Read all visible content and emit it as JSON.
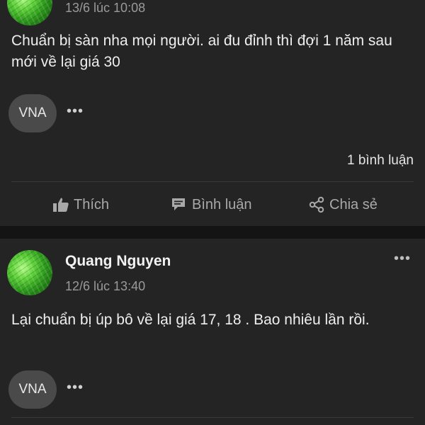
{
  "post1": {
    "timestamp": "13/6 lúc 10:08",
    "body": "Chuẩn bị sàn nha mọi người. ai đu đỉnh thì đợi 1 năm sau mới về lại giá 30",
    "tag": "VNA",
    "tag_more": "•••",
    "comment_count": "1 bình luận",
    "actions": {
      "like": "Thích",
      "comment": "Bình luận",
      "share": "Chia sẻ"
    }
  },
  "post2": {
    "author": "Quang Nguyen",
    "timestamp": "12/6 lúc 13:40",
    "body": "Lại chuẩn bị úp bô về lại giá 17, 18 . Bao nhiêu lần rồi.",
    "tag": "VNA",
    "tag_more": "•••",
    "more_menu": "•••"
  },
  "icons": [
    "thumbs-up-icon",
    "comment-icon",
    "share-icon",
    "more-icon"
  ]
}
